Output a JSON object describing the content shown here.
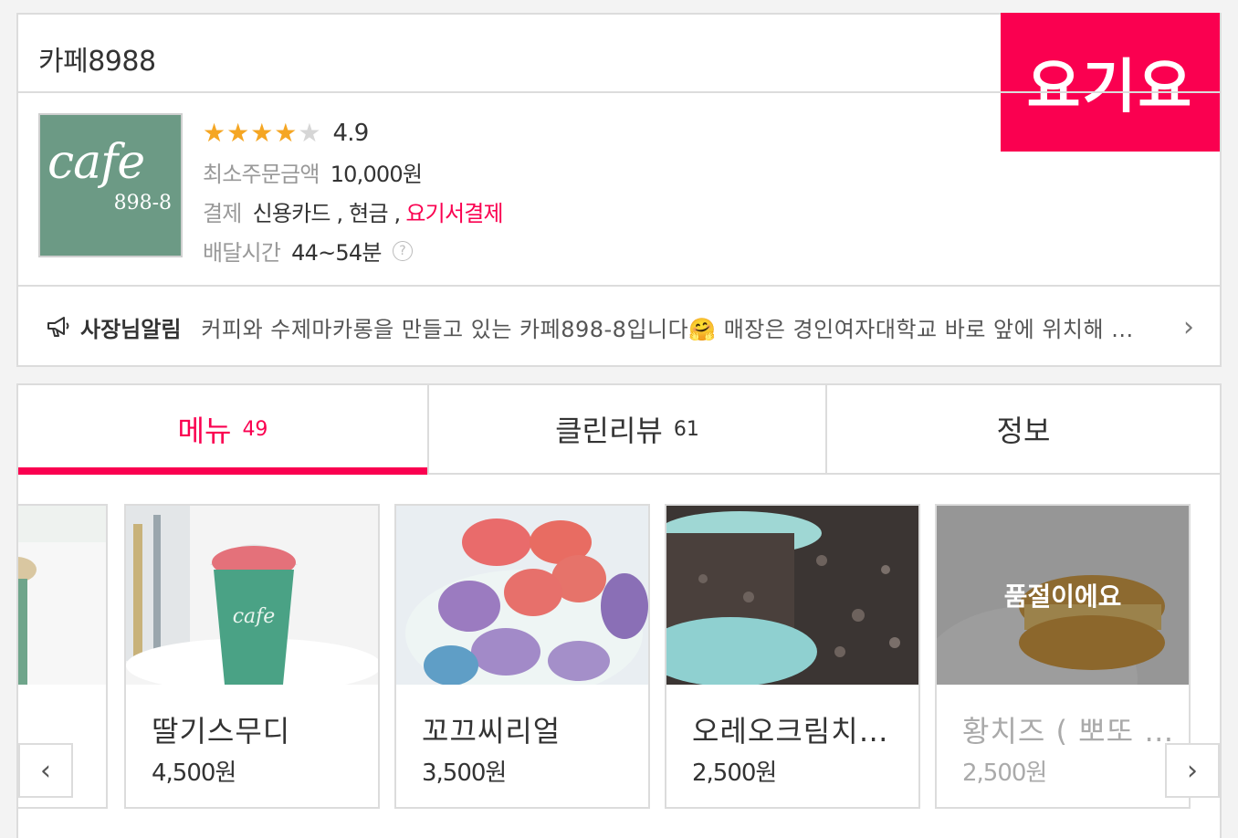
{
  "store": {
    "name": "카페8988",
    "brand": "요기요",
    "logo": {
      "script": "cafe",
      "number": "898-8"
    },
    "rating": "4.9",
    "stars": {
      "filled": 4,
      "total": 5
    },
    "min_order_label": "최소주문금액",
    "min_order_value": "10,000원",
    "payment_label": "결제",
    "payment_methods": "신용카드 , 현금 ,",
    "payment_highlight": "요기서결제",
    "delivery_label": "배달시간",
    "delivery_value": "44~54분",
    "help_icon": "?"
  },
  "notice": {
    "title": "사장님알림",
    "text": "커피와 수제마카롱을 만들고 있는 카페898-8입니다🤗 매장은 경인여자대학교 바로 앞에 위치해 ..."
  },
  "tabs": [
    {
      "label": "메뉴",
      "count": "49"
    },
    {
      "label": "클린리뷰",
      "count": "61"
    },
    {
      "label": "정보",
      "count": ""
    }
  ],
  "menu_items": [
    {
      "name": "",
      "price": ""
    },
    {
      "name": "딸기스무디",
      "price": "4,500원"
    },
    {
      "name": "꼬끄씨리얼",
      "price": "3,500원"
    },
    {
      "name": "오레오크림치즈...",
      "price": "2,500원"
    },
    {
      "name": "황치즈 ( 뽀또 ) ...",
      "price": "2,500원",
      "status": "품절이에요"
    }
  ],
  "nav": {
    "prev": "‹",
    "next": "›"
  },
  "colors": {
    "accent": "#fa0050",
    "star": "#f5a623",
    "logo_bg": "#6c9a85"
  }
}
